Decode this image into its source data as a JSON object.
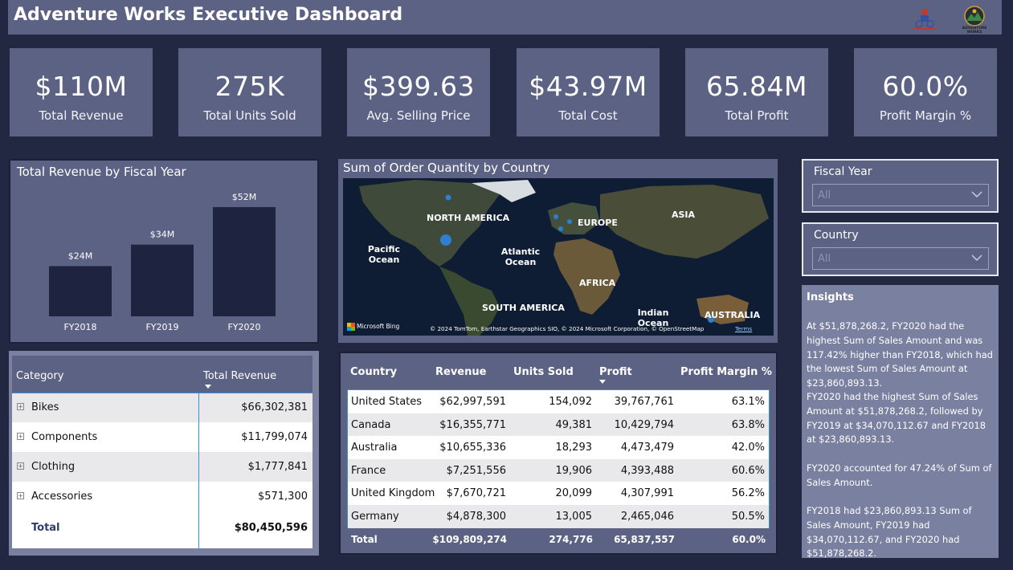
{
  "header": {
    "title": "Adventure Works Executive Dashboard",
    "logos": [
      "adventure-works-bike-icon",
      "adventure-works-logo"
    ],
    "logo_text": "ADVENTURE WORKS"
  },
  "kpis": [
    {
      "value": "$110M",
      "label": "Total Revenue"
    },
    {
      "value": "275K",
      "label": "Total Units Sold"
    },
    {
      "value": "$399.63",
      "label": "Avg. Selling Price"
    },
    {
      "value": "$43.97M",
      "label": "Total Cost"
    },
    {
      "value": "65.84M",
      "label": "Total Profit"
    },
    {
      "value": "60.0%",
      "label": "Profit Margin %"
    }
  ],
  "bar_chart": {
    "title": "Total Revenue by Fiscal Year"
  },
  "chart_data": {
    "type": "bar",
    "title": "Total Revenue by Fiscal Year",
    "categories": [
      "FY2018",
      "FY2019",
      "FY2020"
    ],
    "values": [
      23.86,
      34.07,
      51.88
    ],
    "data_labels": [
      "$24M",
      "$34M",
      "$52M"
    ],
    "xlabel": "",
    "ylabel": "",
    "grid": false,
    "colors": {
      "bar": "#1e2340"
    }
  },
  "map": {
    "title": "Sum of Order Quantity by Country",
    "labels": {
      "north_america": "NORTH AMERICA",
      "europe": "EUROPE",
      "asia": "ASIA",
      "pacific": "Pacific Ocean",
      "atlantic": "Atlantic Ocean",
      "africa": "AFRICA",
      "south_america": "SOUTH AMERICA",
      "indian": "Indian Ocean",
      "australia": "AUSTRALIA"
    },
    "bing": "Microsoft Bing",
    "attribution": "© 2024 TomTom, Earthstar Geographics SIO, © 2024 Microsoft Corporation, © OpenStreetMap",
    "terms": "Terms"
  },
  "slicers": [
    {
      "title": "Fiscal Year",
      "value": "All"
    },
    {
      "title": "Country",
      "value": "All"
    }
  ],
  "insights": {
    "title": "Insights",
    "paragraphs": [
      "At $51,878,268.2, FY2020 had the highest Sum of Sales Amount and was 117.42% higher than FY2018, which had the lowest Sum of Sales Amount at $23,860,893.13.",
      "FY2020 had the highest Sum of Sales Amount at $51,878,268.2, followed by FY2019 at $34,070,112.67 and FY2018 at $23,860,893.13.",
      "FY2020 accounted for 47.24% of Sum of Sales Amount.",
      "FY2018 had $23,860,893.13 Sum of Sales Amount, FY2019 had $34,070,112.67, and FY2020 had $51,878,268.2."
    ]
  },
  "category_table": {
    "headers": [
      "Category",
      "Total Revenue"
    ],
    "rows": [
      {
        "name": "Bikes",
        "revenue": "$66,302,381"
      },
      {
        "name": "Components",
        "revenue": "$11,799,074"
      },
      {
        "name": "Clothing",
        "revenue": "$1,777,841"
      },
      {
        "name": "Accessories",
        "revenue": "$571,300"
      }
    ],
    "total": {
      "name": "Total",
      "revenue": "$80,450,596"
    }
  },
  "country_table": {
    "headers": [
      "Country",
      "Revenue",
      "Units Sold",
      "Profit",
      "Profit Margin %"
    ],
    "rows": [
      [
        "United States",
        "$62,997,591",
        "154,092",
        "39,767,761",
        "63.1%"
      ],
      [
        "Canada",
        "$16,355,771",
        "49,381",
        "10,429,794",
        "63.8%"
      ],
      [
        "Australia",
        "$10,655,336",
        "18,293",
        "4,473,479",
        "42.0%"
      ],
      [
        "France",
        "$7,251,556",
        "19,906",
        "4,393,488",
        "60.6%"
      ],
      [
        "United Kingdom",
        "$7,670,721",
        "20,099",
        "4,307,991",
        "56.2%"
      ],
      [
        "Germany",
        "$4,878,300",
        "13,005",
        "2,465,046",
        "50.5%"
      ]
    ],
    "total": [
      "Total",
      "$109,809,274",
      "274,776",
      "65,837,557",
      "60.0%"
    ]
  }
}
